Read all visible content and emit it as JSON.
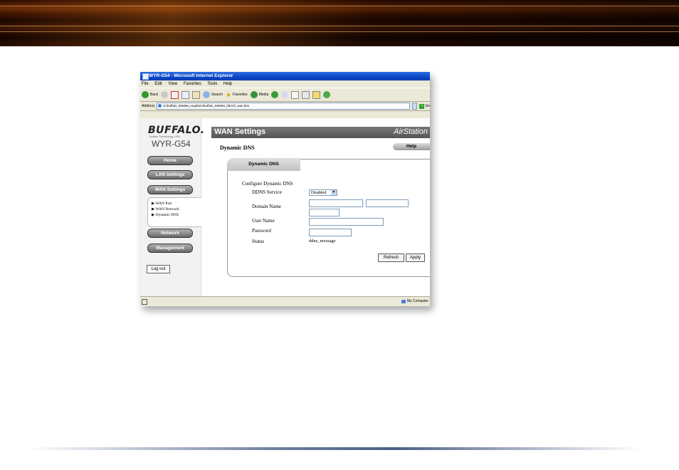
{
  "window": {
    "title": "WYR-G54 - Microsoft Internet Explorer",
    "menu": [
      "File",
      "Edit",
      "View",
      "Favorites",
      "Tools",
      "Help"
    ],
    "toolbar": {
      "back": "Back",
      "search": "Search",
      "favorites": "Favorites",
      "media": "Media"
    },
    "address_label": "Address",
    "address_value": "D:\\buffalo_8065M_eng0821\\buffalo_8065M_0821\\f_wan.htm",
    "go_label": "Go",
    "status_right": "My Computer"
  },
  "sidebar": {
    "logo": "BUFFALO.",
    "logo_sub": "Buffalo Technology USA",
    "model": "WYR-G54",
    "nav": [
      "Home",
      "LAN Settings",
      "WAN Settings",
      "Network",
      "Management"
    ],
    "submenu": [
      "WAN Port",
      "WAN Network",
      "Dynamic DNS"
    ],
    "logout": "Log out"
  },
  "main": {
    "header_title": "WAN Settings",
    "header_brand": "AirStation",
    "page_subtitle": "Dynamic DNS",
    "help": "Help",
    "tab": "Dynamic DNS",
    "form_heading": "Configure Dynamic DNS",
    "labels": {
      "ddns_service": "DDNS Service",
      "domain_name": "Domain Name",
      "user_name": "User Name",
      "password": "Password",
      "status": "Status"
    },
    "ddns_service_value": "Disabled",
    "status_value": "ddns_message",
    "refresh": "Refresh",
    "apply": "Apply"
  },
  "colors": {
    "banner": "#3a1200",
    "ie_title": "#0a46c8",
    "header_bar": "#666666",
    "nav_button": "#7a7a7a"
  }
}
